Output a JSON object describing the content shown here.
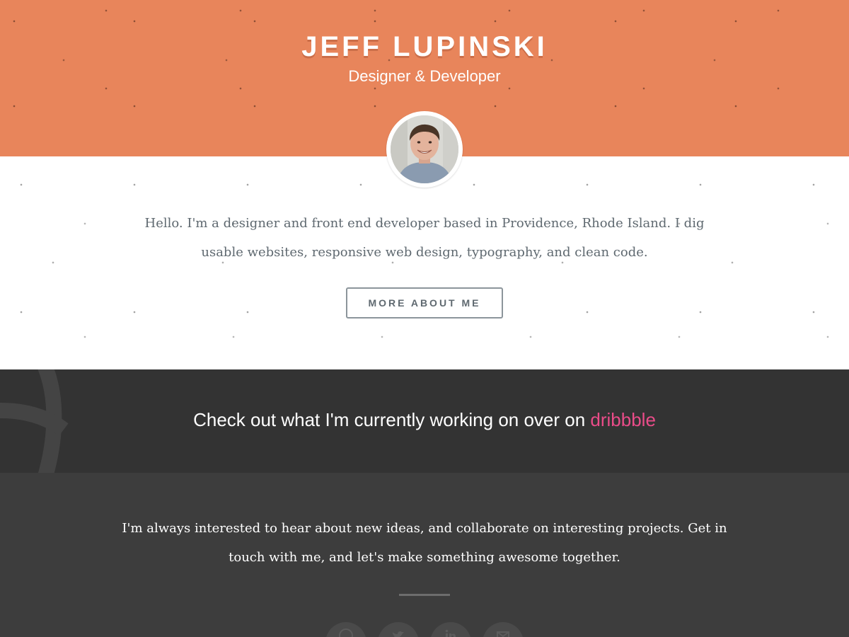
{
  "colors": {
    "hero_bg": "#e8855b",
    "dark_band": "#333333",
    "contact_bg": "#3d3d3d",
    "accent_link": "#ea4c89",
    "body_text": "#5f6970"
  },
  "hero": {
    "title": "JEFF LUPINSKI",
    "subtitle": "Designer & Developer"
  },
  "intro": {
    "avatar_icon": "profile-photo",
    "text": "Hello. I'm a designer and front end developer based in Providence, Rhode Island. I dig usable websites, responsive web design, typography, and clean code.",
    "button_label": "MORE ABOUT ME"
  },
  "dribbble": {
    "text": "Check out what I'm currently working on over on ",
    "link_label": "dribbble",
    "icon": "dribbble-icon"
  },
  "contact": {
    "text": "I'm always interested to hear about new ideas, and collaborate on interesting projects. Get in touch with me, and let's make something awesome together.",
    "social": [
      {
        "name": "dribbble",
        "icon": "dribbble-icon"
      },
      {
        "name": "twitter",
        "icon": "twitter-icon"
      },
      {
        "name": "linkedin",
        "icon": "linkedin-icon"
      },
      {
        "name": "email",
        "icon": "email-icon"
      }
    ]
  }
}
